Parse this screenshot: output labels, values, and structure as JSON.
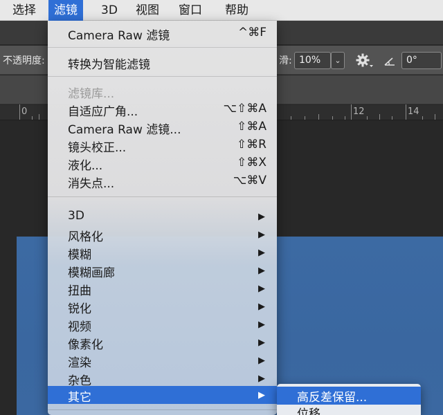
{
  "menubar": {
    "items": [
      {
        "label": "选择",
        "active": false
      },
      {
        "label": "滤镜",
        "active": true
      },
      {
        "label": "3D",
        "active": false
      },
      {
        "label": "视图",
        "active": false
      },
      {
        "label": "窗口",
        "active": false
      },
      {
        "label": "帮助",
        "active": false
      }
    ]
  },
  "options_bar": {
    "opacity_label": "不透明度:",
    "smooth_label": "滑:",
    "smooth_value": "10%",
    "angle_value": "0°",
    "icons": [
      "gear-icon",
      "angle-icon",
      "chevron-down-icon"
    ]
  },
  "ruler": {
    "labels": [
      "0",
      "12",
      "14"
    ]
  },
  "filter_menu": {
    "items": [
      {
        "label": "Camera Raw 滤镜",
        "shortcut": "^⌘F"
      },
      {
        "label": "转换为智能滤镜",
        "shortcut": ""
      },
      {
        "label": "滤镜库...",
        "shortcut": "",
        "disabled": true
      },
      {
        "label": "自适应广角...",
        "shortcut": "⌥⇧⌘A"
      },
      {
        "label": "Camera Raw 滤镜...",
        "shortcut": "⇧⌘A"
      },
      {
        "label": "镜头校正...",
        "shortcut": "⇧⌘R"
      },
      {
        "label": "液化...",
        "shortcut": "⇧⌘X"
      },
      {
        "label": "消失点...",
        "shortcut": "⌥⌘V"
      },
      {
        "label": "3D",
        "submenu_arrow": "▶"
      },
      {
        "label": "风格化",
        "submenu_arrow": "▶"
      },
      {
        "label": "模糊",
        "submenu_arrow": "▶"
      },
      {
        "label": "模糊画廊",
        "submenu_arrow": "▶"
      },
      {
        "label": "扭曲",
        "submenu_arrow": "▶"
      },
      {
        "label": "锐化",
        "submenu_arrow": "▶"
      },
      {
        "label": "视频",
        "submenu_arrow": "▶"
      },
      {
        "label": "像素化",
        "submenu_arrow": "▶"
      },
      {
        "label": "渲染",
        "submenu_arrow": "▶"
      },
      {
        "label": "杂色",
        "submenu_arrow": "▶"
      },
      {
        "label": "其它",
        "submenu_arrow": "▶",
        "highlighted": true
      }
    ]
  },
  "other_submenu": {
    "items": [
      {
        "label": "高反差保留...",
        "highlighted": true
      },
      {
        "label": "位移",
        "highlighted": false
      }
    ]
  },
  "colors": {
    "accent": "#2f6fd6",
    "canvas": "#3b68a1",
    "workspace": "#282828"
  }
}
